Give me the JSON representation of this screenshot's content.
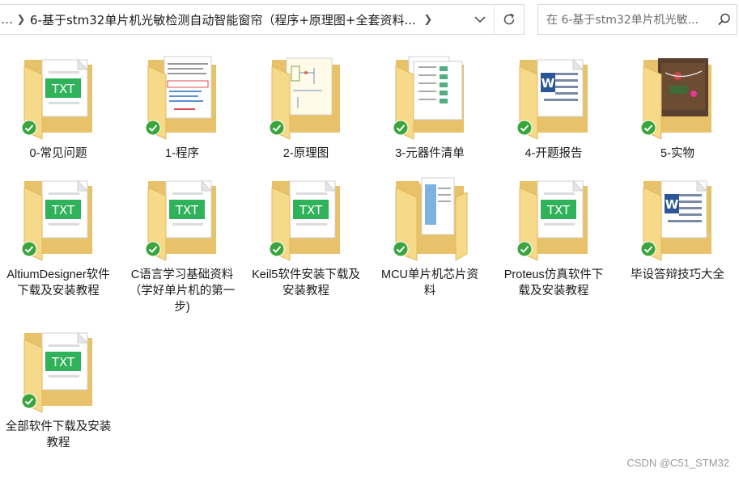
{
  "toolbar": {
    "ellipsis": "…",
    "path_text": "6-基于stm32单片机光敏检测自动智能窗帘（程序+原理图+全套资料...",
    "search_placeholder": "在 6-基于stm32单片机光敏..."
  },
  "items": [
    {
      "label": "0-常见问题",
      "icon": "folder-txt-icon"
    },
    {
      "label": "1-程序",
      "icon": "folder-code-doc-icon"
    },
    {
      "label": "2-原理图",
      "icon": "folder-schematic-icon"
    },
    {
      "label": "3-元器件清单",
      "icon": "folder-spreadsheet-icon"
    },
    {
      "label": "4-开题报告",
      "icon": "folder-word-icon"
    },
    {
      "label": "5-实物",
      "icon": "folder-photo-icon"
    },
    {
      "label": "AltiumDesigner软件下载及安装教程",
      "icon": "folder-txt-icon"
    },
    {
      "label": "C语言学习基础资料（学好单片机的第一步)",
      "icon": "folder-txt-icon"
    },
    {
      "label": "Keil5软件安装下载及安装教程",
      "icon": "folder-txt-icon"
    },
    {
      "label": "MCU单片机芯片资料",
      "icon": "folder-docs-icon"
    },
    {
      "label": "Proteus仿真软件下载及安装教程",
      "icon": "folder-txt-icon"
    },
    {
      "label": "毕设答辩技巧大全",
      "icon": "folder-word-icon"
    },
    {
      "label": "全部软件下载及安装教程",
      "icon": "folder-txt-icon"
    }
  ],
  "watermark": "CSDN @C51_STM32",
  "colors": {
    "folder_back": "#e8c26a",
    "folder_front": "#f7d98a",
    "txt_badge": "#2fb25a",
    "check": "#3aa53d"
  }
}
